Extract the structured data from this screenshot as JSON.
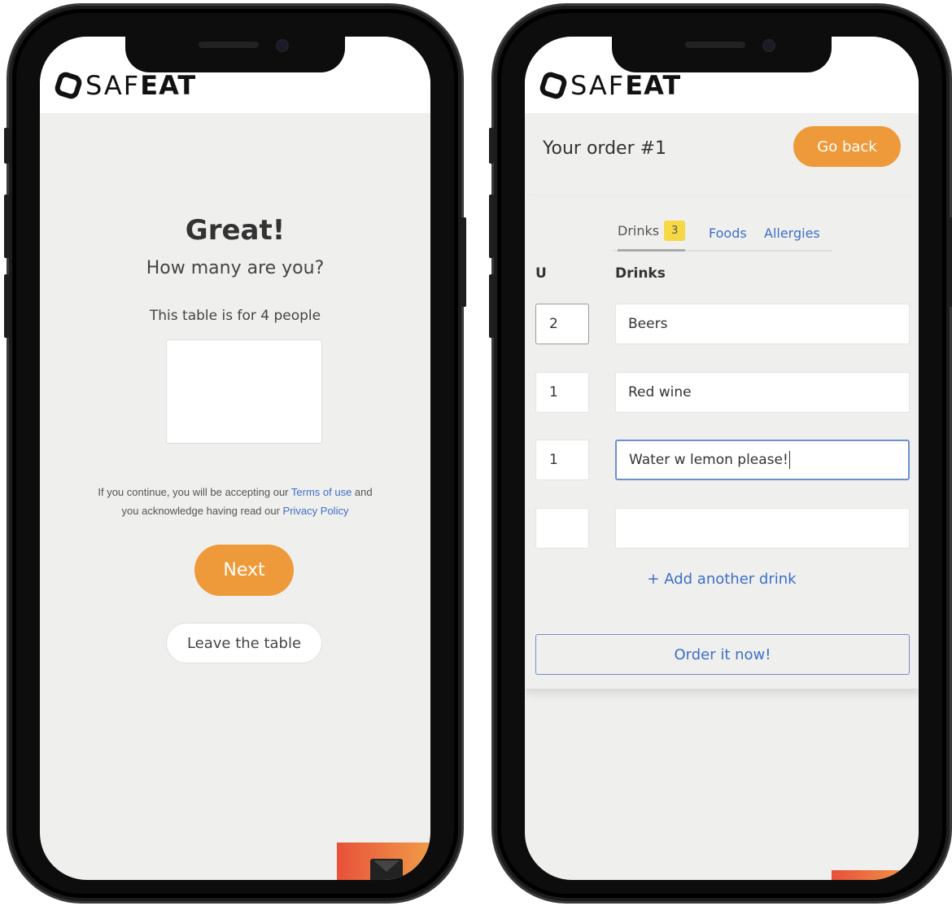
{
  "brand": {
    "logo_light": "SAF",
    "logo_bold": "EAT"
  },
  "left": {
    "title": "Great!",
    "subtitle": "How many are you?",
    "caption": "This table is for 4 people",
    "people_value": "",
    "legal_pre": "If you continue, you will be accepting our ",
    "terms_link": "Terms of use",
    "legal_mid": " and",
    "legal_line2_pre": "you acknowledge having read our ",
    "privacy_link": "Privacy Policy",
    "next_label": "Next",
    "leave_label": "Leave the table"
  },
  "right": {
    "order_title": "Your order #1",
    "go_back_label": "Go back",
    "tabs": [
      {
        "label": "Drinks",
        "badge": "3"
      },
      {
        "label": "Foods"
      },
      {
        "label": "Allergies"
      }
    ],
    "col_qty": "U",
    "col_name": "Drinks",
    "rows": [
      {
        "qty": "2",
        "name": "Beers"
      },
      {
        "qty": "1",
        "name": "Red wine"
      },
      {
        "qty": "1",
        "name": "Water w lemon please!"
      },
      {
        "qty": "",
        "name": ""
      }
    ],
    "add_label": "+ Add another drink",
    "order_label": "Order it now!"
  },
  "colors": {
    "accent": "#ee9a3a",
    "link": "#3d6fc7",
    "badge": "#f6d844",
    "screen_bg": "#efefed"
  },
  "icons": [
    "logo-mark-icon",
    "mail-icon"
  ]
}
